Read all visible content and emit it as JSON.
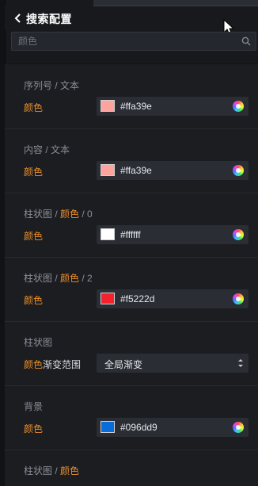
{
  "header": {
    "title": "搜索配置"
  },
  "search": {
    "placeholder": "颜色"
  },
  "sections": [
    {
      "title_a": "序列号 / 文本",
      "title_hl": "",
      "title_b": "",
      "label": "颜色",
      "swatch": "#ffa39e",
      "hex": "#ffa39e"
    },
    {
      "title_a": "内容 / 文本",
      "title_hl": "",
      "title_b": "",
      "label": "颜色",
      "swatch": "#ffa39e",
      "hex": "#ffa39e"
    },
    {
      "title_a": "柱状图 / ",
      "title_hl": "颜色",
      "title_b": " / 0",
      "label": "颜色",
      "swatch": "#ffffff",
      "hex": "#ffffff"
    },
    {
      "title_a": "柱状图 / ",
      "title_hl": "颜色",
      "title_b": " / 2",
      "label": "颜色",
      "swatch": "#f5222d",
      "hex": "#f5222d"
    },
    {
      "title_a": "柱状图",
      "title_hl": "",
      "title_b": "",
      "label": "颜色",
      "label_rest": "渐变范围",
      "select_value": "全局渐变"
    },
    {
      "title_a": "背景",
      "title_hl": "",
      "title_b": "",
      "label": "颜色",
      "swatch": "#096dd9",
      "hex": "#096dd9"
    },
    {
      "title_a": "柱状图 / ",
      "title_hl": "颜色",
      "title_b": ""
    }
  ]
}
